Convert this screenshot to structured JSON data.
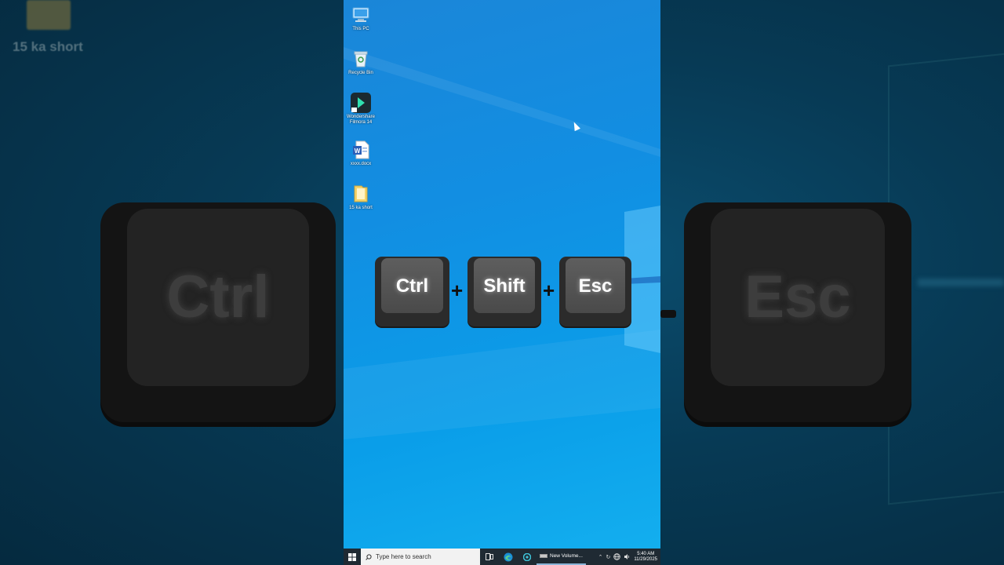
{
  "background": {
    "folder_label": "15 ka short",
    "left_key_label": "Ctrl",
    "right_key_label": "Esc"
  },
  "desktop": {
    "icons": [
      {
        "name": "monitor-icon",
        "label": "This PC"
      },
      {
        "name": "recycle-bin-icon",
        "label": "Recycle Bin"
      },
      {
        "name": "filmora-icon",
        "label": "Wondershare Filmora 14"
      },
      {
        "name": "word-doc-icon",
        "label": "xxxx.docx"
      },
      {
        "name": "folder-icon",
        "label": "15 ka short"
      }
    ]
  },
  "shortcut": {
    "keys": [
      "Ctrl",
      "Shift",
      "Esc"
    ],
    "separator": "+"
  },
  "taskbar": {
    "search_placeholder": "Type here to search",
    "active_app_label": "New Volume...",
    "time": "5:40 AM",
    "date": "11/29/2025"
  },
  "colors": {
    "desktop_blue": "#128ee2",
    "taskbar": "#1f2a33",
    "key_face": "#555555"
  }
}
